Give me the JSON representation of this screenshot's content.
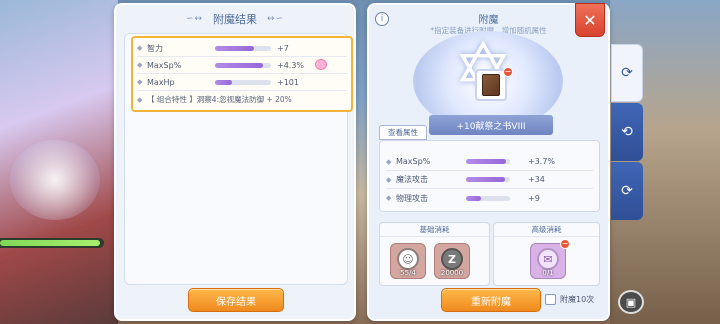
{
  "result_panel": {
    "title": "附魔结果",
    "deco_left": "∽↔",
    "deco_right": "↔∽",
    "stats": [
      {
        "name": "智力",
        "value": "+7",
        "fill": 0.7
      },
      {
        "name": "MaxSp%",
        "value": "+4.3%",
        "fill": 0.85
      },
      {
        "name": "MaxHp",
        "value": "+101",
        "fill": 0.3
      }
    ],
    "combo_text": "【 组合特性 】洞察4:忽视魔法防御 + 20%",
    "save_label": "保存结果"
  },
  "enchant_panel": {
    "title": "附魔",
    "subtitle": "*指定装备进行附魔，增加随机属性",
    "info_icon": "i",
    "close_icon": "✕",
    "item_name": "+10献祭之书VIII",
    "attr_tab_label": "查看属性",
    "attributes": [
      {
        "name": "MaxSp%",
        "value": "+3.7%",
        "fill": 0.92
      },
      {
        "name": "魔法攻击",
        "value": "+34",
        "fill": 0.88
      },
      {
        "name": "物理攻击",
        "value": "+9",
        "fill": 0.35
      }
    ],
    "base_cost_title": "基础消耗",
    "adv_cost_title": "高级消耗",
    "materials": {
      "m1_count": "55/4",
      "m1_glyph": "☺",
      "m2_count": "20000",
      "m2_glyph": "Z",
      "m3_count": "0/1",
      "m3_glyph": "✉"
    },
    "reenchant_label": "重新附魔",
    "enchant10_label": "附魔10次"
  },
  "side_tabs": [
    {
      "icon": "enchant-tab-icon-1",
      "glyph": "⟳"
    },
    {
      "icon": "enchant-tab-icon-2",
      "glyph": "⟲"
    },
    {
      "icon": "enchant-tab-icon-3",
      "glyph": "⟳"
    }
  ]
}
